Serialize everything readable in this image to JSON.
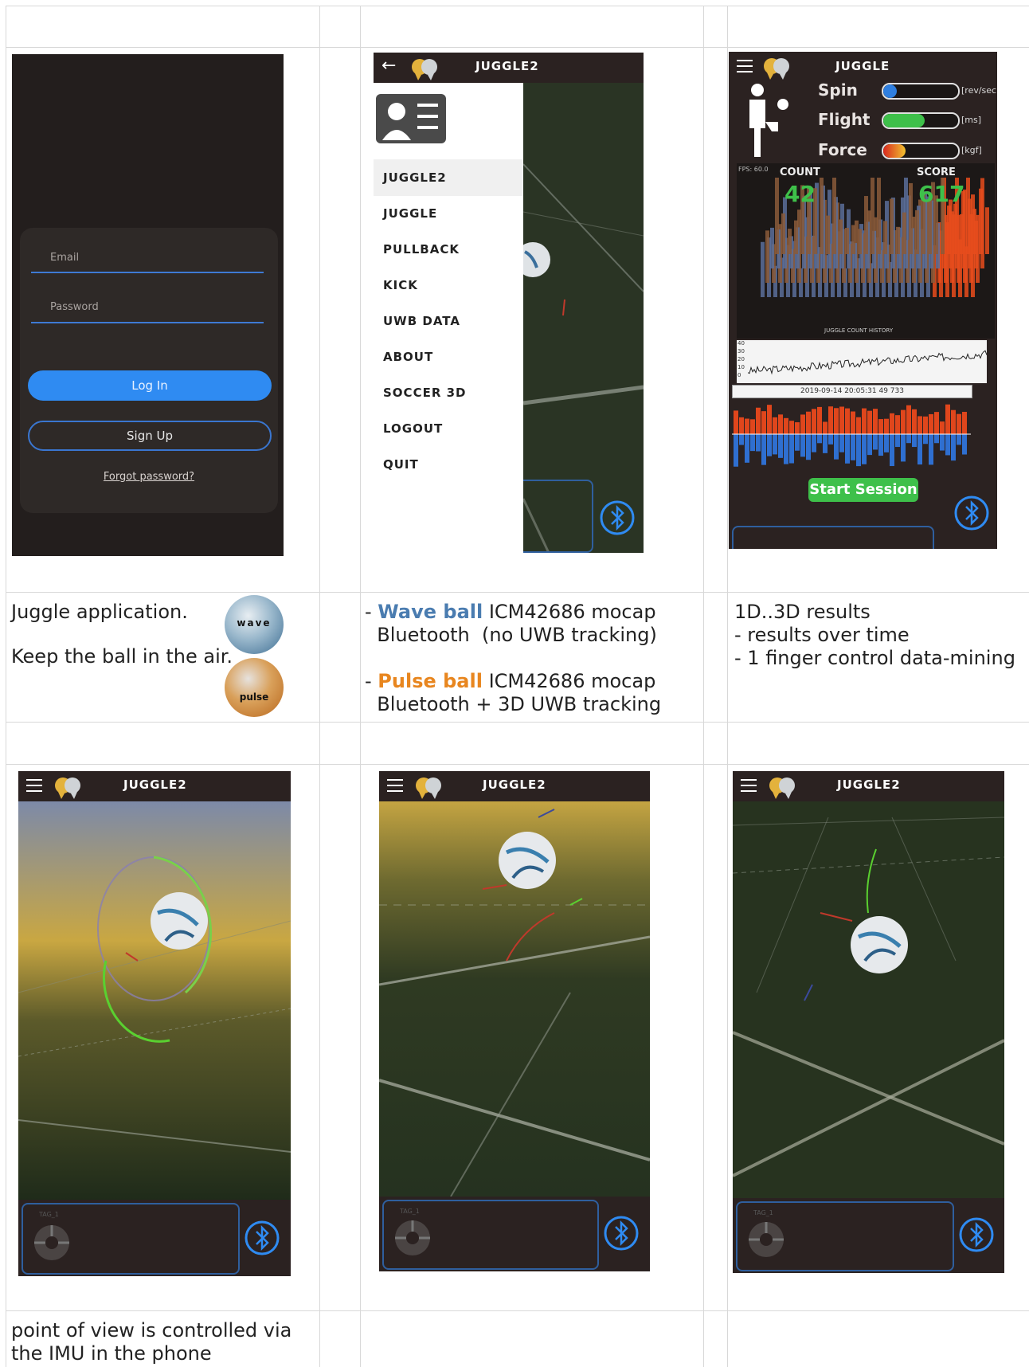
{
  "row1": {
    "login": {
      "email_placeholder": "Email",
      "password_placeholder": "Password",
      "login_label": "Log In",
      "signup_label": "Sign Up",
      "forgot_label": "Forgot password?"
    },
    "menu": {
      "title": "JUGGLE2",
      "items": [
        "JUGGLE2",
        "JUGGLE",
        "PULLBACK",
        "KICK",
        "UWB DATA",
        "ABOUT",
        "SOCCER 3D",
        "LOGOUT",
        "QUIT"
      ],
      "selected_index": 0
    },
    "stats": {
      "title": "JUGGLE",
      "spin_label": "Spin",
      "flight_label": "Flight",
      "force_label": "Force",
      "spin_unit": "[rev/sec]",
      "flight_unit": "[ms]",
      "force_unit": "[kgf]",
      "spin_level": 0.18,
      "flight_level": 0.55,
      "force_level": 0.3,
      "fps_label": "FPS: 60.0",
      "count_label": "COUNT",
      "count_value": "42",
      "score_label": "SCORE",
      "score_value": "617",
      "history_caption": "JUGGLE COUNT HISTORY",
      "y_ticks": [
        "40",
        "30",
        "20",
        "10",
        "0"
      ],
      "timestamp": "2019-09-14 20:05:31 49 733",
      "start_label": "Start Session"
    }
  },
  "row2": {
    "col1_line1": "Juggle application.",
    "col1_line2": "Keep the ball in the air.",
    "wave_ball_text": "wave",
    "pulse_ball_text": "pulse",
    "col2_wave_prefix": "- ",
    "col2_wave_name": "Wave ball",
    "col2_wave_rest": " ICM42686 mocap",
    "col2_wave_line2": "  Bluetooth  (no UWB tracking)",
    "col2_pulse_prefix": "- ",
    "col2_pulse_name": "Pulse ball",
    "col2_pulse_rest": " ICM42686 mocap",
    "col2_pulse_line2": "  Bluetooth + 3D UWB tracking",
    "col3_line1": "1D..3D results",
    "col3_line2": "- results over time",
    "col3_line3": "- 1 finger control data-mining"
  },
  "row3": {
    "title": "JUGGLE2",
    "device_tag": "TAG_1"
  },
  "row4": {
    "col1_line1": "point of view is controlled via",
    "col1_line2": "the IMU in the phone"
  },
  "colors": {
    "accent_blue": "#2f8bf2",
    "wave_blue": "#4a7cb0",
    "pulse_orange": "#e8861f",
    "start_green": "#3ec04a"
  }
}
